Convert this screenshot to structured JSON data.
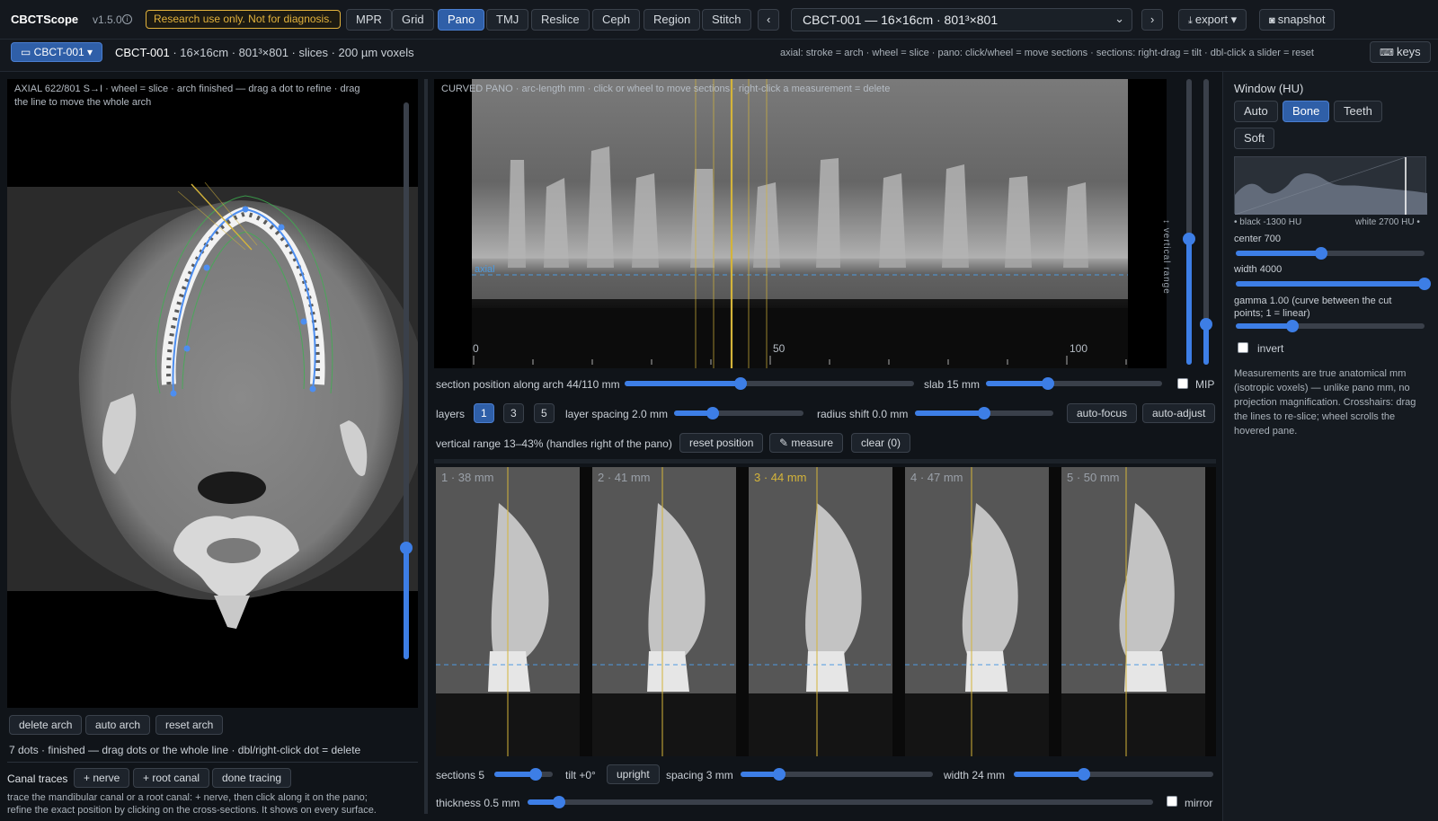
{
  "app": {
    "name": "CBCTScope",
    "version": "v1.5.0",
    "info_icon": "info-icon",
    "warning": "Research use only. Not for diagnosis."
  },
  "modes": [
    "MPR",
    "Grid",
    "Pano",
    "TMJ",
    "Reslice",
    "Ceph",
    "Region",
    "Stitch"
  ],
  "active_mode": "Pano",
  "study_select": {
    "value": "CBCT-001 — 16×16cm · 801³×801",
    "prev": "‹",
    "next": "›"
  },
  "export_label": "export ▾",
  "snapshot_label": "snapshot",
  "keys_label": "keys",
  "subbar": {
    "case_chip": "CBCT-001 ▾",
    "case_name": "CBCT-001",
    "case_info": " · 16×16cm · 801³×801 · slices · 200 µm voxels",
    "hint": "axial: stroke = arch · wheel = slice · pano: click/wheel = move sections · sections: right-drag = tilt · dbl-click a slider = reset"
  },
  "axial": {
    "overlay_line1": "AXIAL 622/801 S→I · wheel = slice · arch finished — drag a dot to refine · drag",
    "overlay_line2": "the line to move the whole arch",
    "slice_fraction": 0.2,
    "buttons": [
      "delete arch",
      "auto arch",
      "reset arch"
    ],
    "status": "7 dots · finished — drag dots or the whole line · dbl/right-click dot = delete",
    "canal_label": "Canal traces",
    "canal_buttons": [
      "+ nerve",
      "+ root canal",
      "done tracing"
    ],
    "canal_help_1": "trace the mandibular canal or a root canal: + nerve, then click along it on the pano;",
    "canal_help_2": "refine the exact position by clicking on the cross-sections. It shows on every surface."
  },
  "pano": {
    "overlay": "CURVED PANO · arc-length mm · click or wheel to move sections · right-click a measurement = delete",
    "axial_tag": "axial",
    "ticks": [
      "0",
      "50",
      "100"
    ],
    "vertical_range_label": "↕ vertical range",
    "vr_low": 0.13,
    "vr_high": 0.43
  },
  "controls": {
    "section_pos_label": "section position along arch 44/110 mm",
    "section_pos": 0.4,
    "slab_label": "slab 15 mm",
    "slab": 0.35,
    "mip_label": "MIP",
    "layers_label": "layers",
    "layers": [
      "1",
      "3",
      "5"
    ],
    "layers_active": "1",
    "layer_spacing_label": "layer spacing 2.0 mm",
    "layer_spacing": 0.3,
    "radius_label": "radius shift 0.0 mm",
    "radius": 0.5,
    "auto_focus": "auto-focus",
    "auto_adjust": "auto-adjust",
    "vr_label": "vertical range 13–43% (handles right of the pano)",
    "reset_position": "reset position",
    "measure": "measure",
    "clear": "clear (0)"
  },
  "sections": [
    {
      "label": "1 · 38 mm",
      "active": false
    },
    {
      "label": "2 · 41 mm",
      "active": false
    },
    {
      "label": "3 · 44 mm",
      "active": true
    },
    {
      "label": "4 · 47 mm",
      "active": false
    },
    {
      "label": "5 · 50 mm",
      "active": false
    }
  ],
  "section_controls": {
    "sections_label": "sections 5",
    "sections_value": 0.7,
    "tilt_label": "tilt +0°",
    "upright": "upright",
    "spacing_label": "spacing 3 mm",
    "spacing_value": 0.2,
    "width_label": "width 24 mm",
    "width_value": 0.35,
    "thickness_label": "thickness 0.5 mm",
    "thickness_value": 0.05,
    "mirror_label": "mirror"
  },
  "window": {
    "title": "Window (HU)",
    "presets": [
      "Auto",
      "Bone",
      "Teeth",
      "Soft"
    ],
    "active_preset": "Bone",
    "black_label": "• black -1300 HU",
    "white_label": "white 2700 HU •",
    "center_label": "center 700",
    "center_value": 0.45,
    "width_label": "width 4000",
    "width_value": 1.0,
    "gamma_label": "gamma 1.00 (curve between the cut points; 1 = linear)",
    "gamma_value": 0.3,
    "invert_label": "invert",
    "note": "Measurements are true anatomical mm (isotropic voxels) — unlike pano mm, no projection magnification. Crosshairs: drag the lines to re-slice; wheel scrolls the hovered pane."
  },
  "colors": {
    "accent": "#3d7ee6",
    "warning": "#e2b23c",
    "section_line": "#d4b43a"
  }
}
